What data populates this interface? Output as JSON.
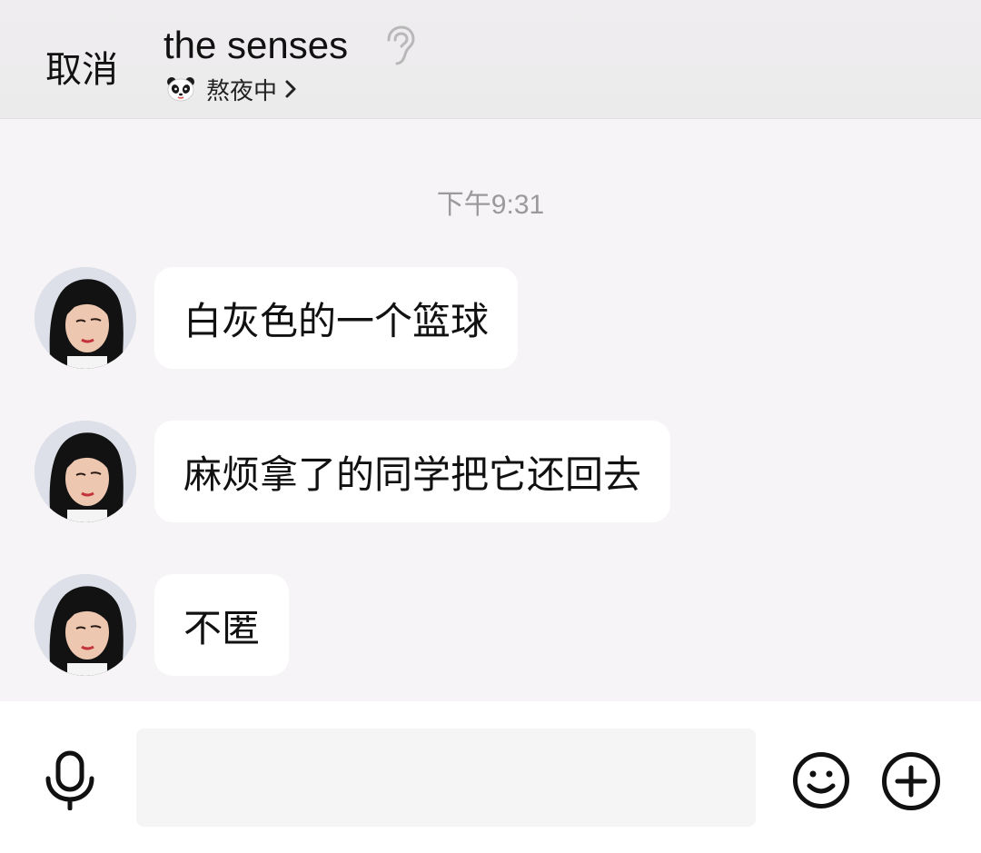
{
  "header": {
    "cancel_label": "取消",
    "contact_name": "the senses",
    "status_text": "熬夜中",
    "ear_icon": "ear-icon",
    "status_icon": "panda-icon"
  },
  "chat": {
    "timestamp": "下午9:31",
    "messages": [
      {
        "text": "白灰色的一个篮球",
        "avatar": "avatar"
      },
      {
        "text": "麻烦拿了的同学把它还回去",
        "avatar": "avatar"
      },
      {
        "text": "不匿",
        "avatar": "avatar"
      }
    ]
  },
  "input_bar": {
    "input_value": "",
    "input_placeholder": "",
    "mic_icon": "microphone-icon",
    "emoji_icon": "smiley-icon",
    "plus_icon": "plus-circle-icon"
  },
  "colors": {
    "header_bg": "#eeecee",
    "chat_bg": "#f6f4f6",
    "bubble_bg": "#ffffff",
    "timestamp": "#9a9a9a"
  }
}
